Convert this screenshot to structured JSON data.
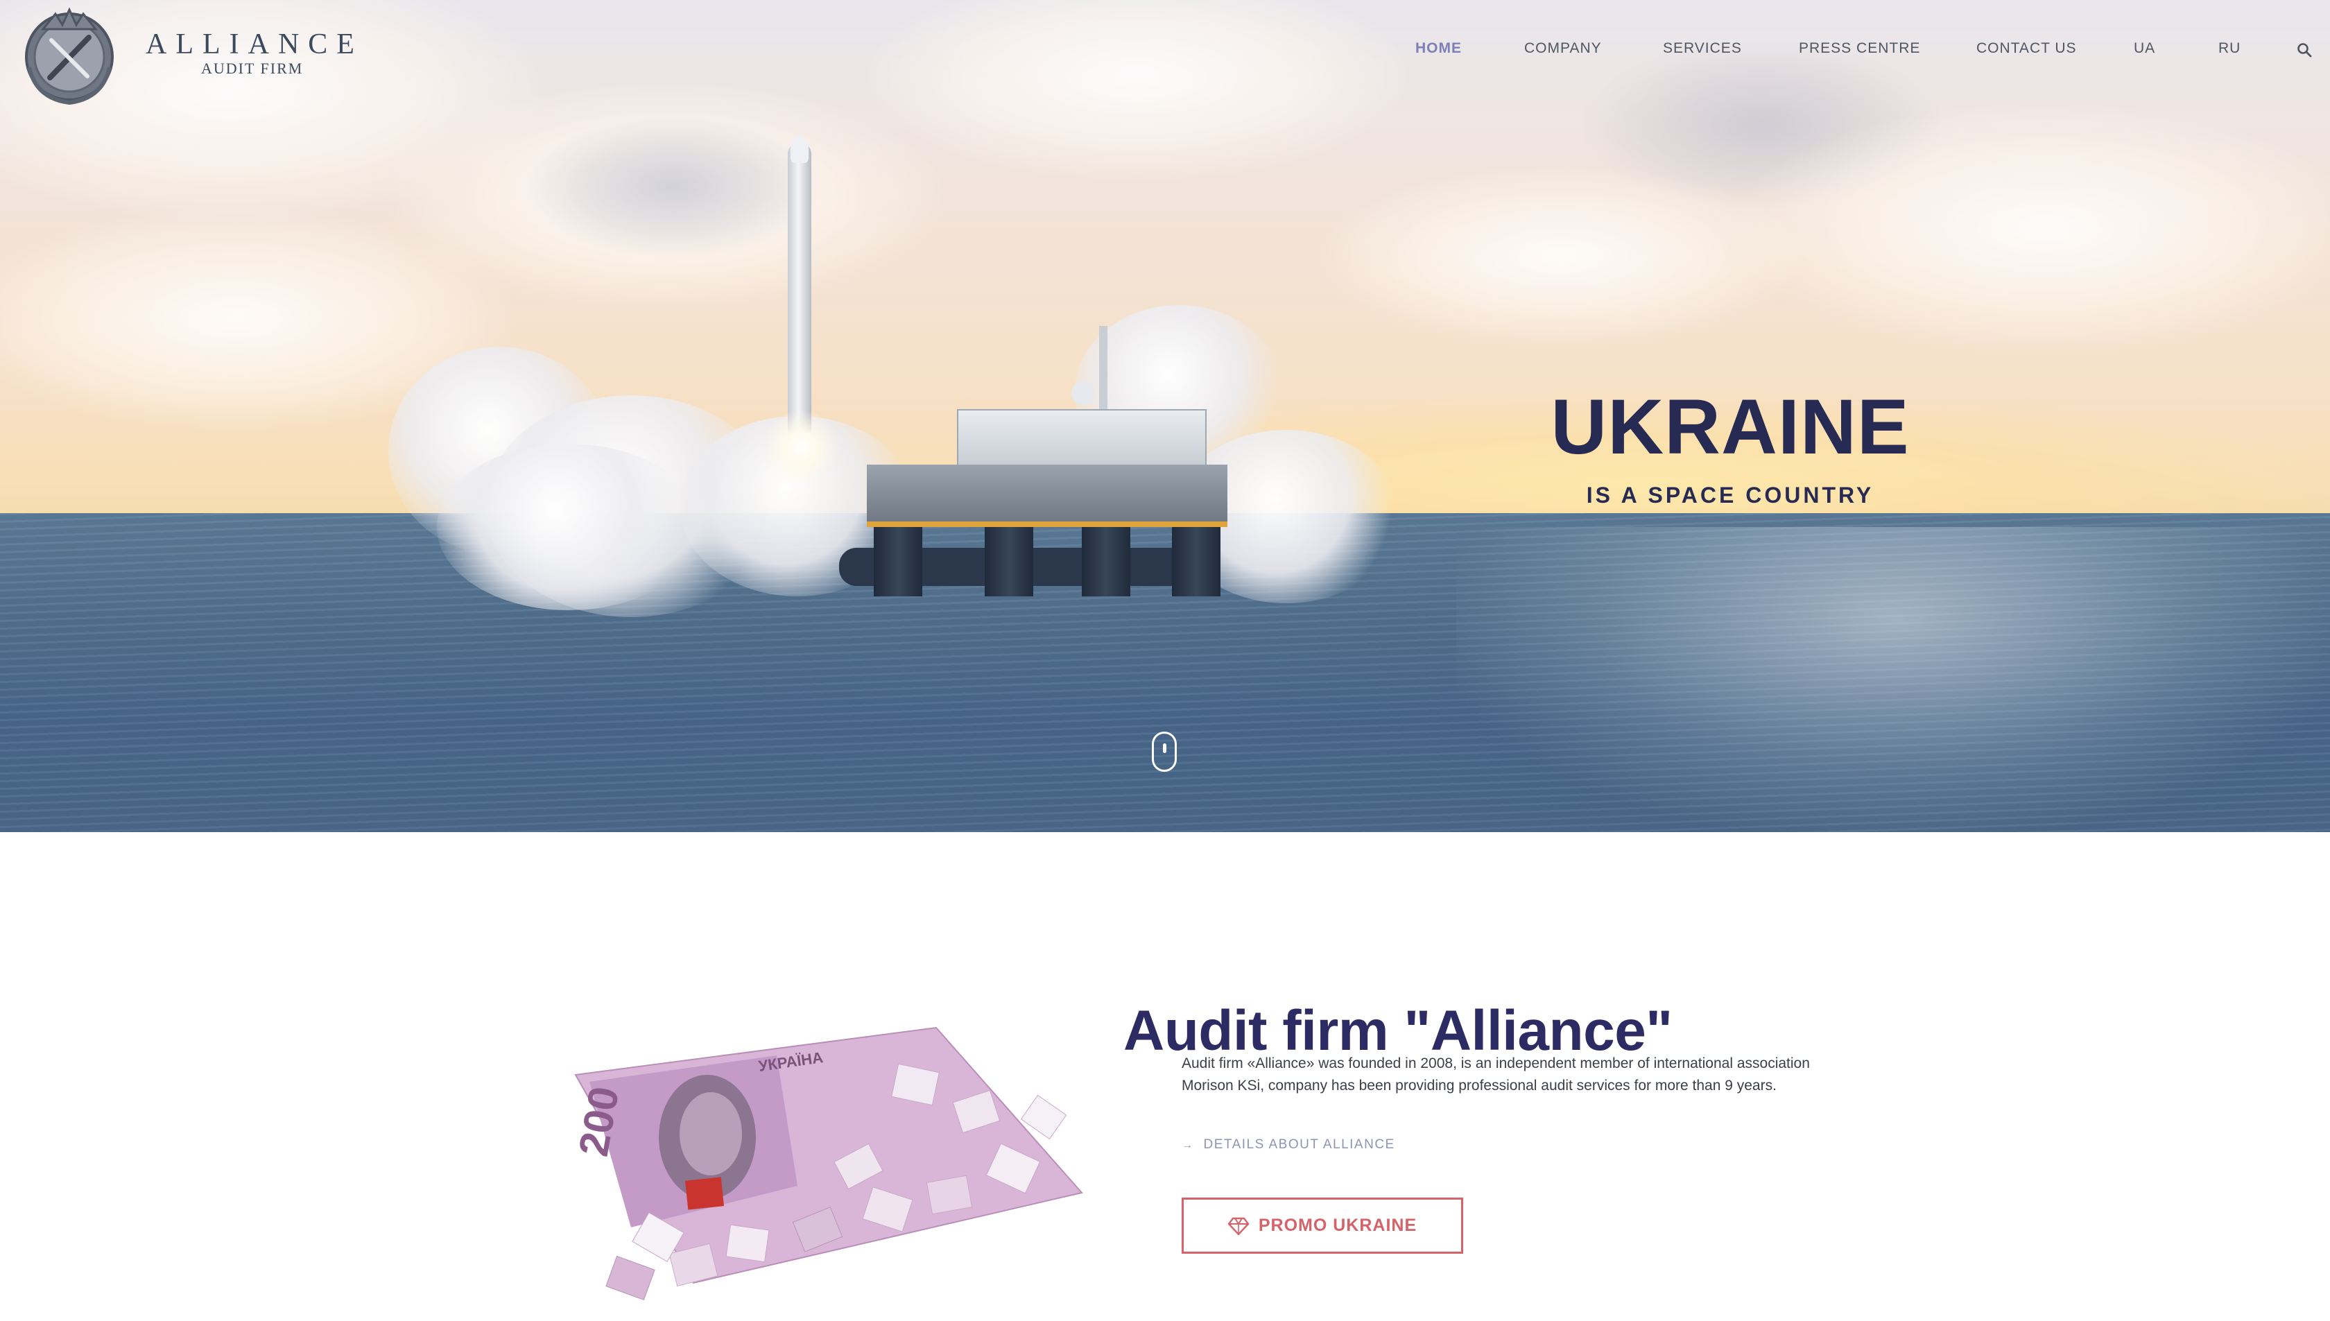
{
  "logo": {
    "name": "ALLIANCE",
    "subtitle": "AUDIT FIRM"
  },
  "nav": {
    "items": [
      {
        "label": "HOME",
        "active": true
      },
      {
        "label": "COMPANY",
        "active": false
      },
      {
        "label": "SERVICES",
        "active": false
      },
      {
        "label": "PRESS CENTRE",
        "active": false
      },
      {
        "label": "CONTACT US",
        "active": false
      },
      {
        "label": "UA",
        "active": false
      },
      {
        "label": "RU",
        "active": false
      }
    ],
    "search_icon": "search-icon"
  },
  "hero": {
    "title": "UKRAINE",
    "subtitle": "IS A SPACE COUNTRY",
    "scroll_icon": "mouse-scroll-icon"
  },
  "about": {
    "heading": "Audit firm \"Alliance\"",
    "text": "Audit firm «Alliance» was founded in 2008, is an independent member of international association Morison KSi, company has been providing professional audit services for more than 9 years.",
    "details_link": "DETAILS ABOUT ALLIANCE",
    "promo_button": "PROMO UKRAINE",
    "banknote_denomination": "200",
    "banknote_country": "УКРАЇНА"
  },
  "colors": {
    "accent": "#7d7fb6",
    "heading": "#2c2b63",
    "hero_title": "#272b53",
    "promo": "#d4636a",
    "link": "#8e95b3"
  }
}
